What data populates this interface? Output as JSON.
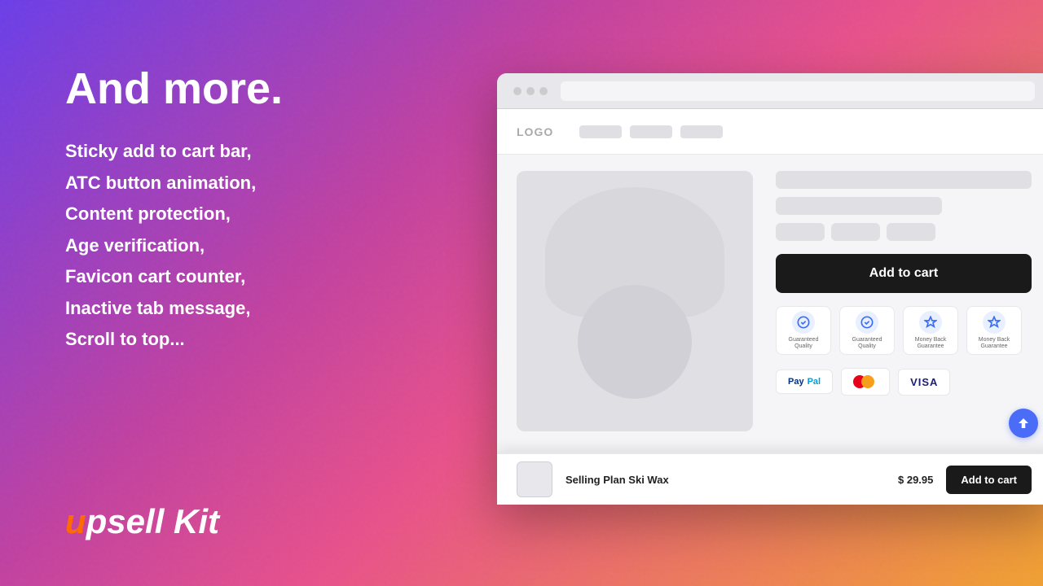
{
  "background": {
    "gradient": "linear-gradient(135deg, #6a3de8 0%, #c040a0 35%, #e8508a 55%, #f0a030 100%)"
  },
  "left_panel": {
    "headline": "And more.",
    "features": [
      "Sticky add to cart bar,",
      "ATC button animation,",
      "Content protection,",
      "Age verification,",
      "Favicon cart counter,",
      "Inactive tab message,",
      "Scroll to top..."
    ]
  },
  "logo": {
    "u": "u",
    "psell": "psell",
    "kit": " Kit"
  },
  "browser": {
    "nav": {
      "logo": "LOGO",
      "links": [
        "",
        "",
        ""
      ]
    },
    "product": {
      "add_to_cart_label": "Add to cart",
      "trust_badges": [
        {
          "icon": "✓",
          "text": "Guaranteed\nQuality"
        },
        {
          "icon": "✓",
          "text": "Guaranteed\nQuality"
        },
        {
          "icon": "$",
          "text": "Money Back\nGuarantee"
        },
        {
          "icon": "$",
          "text": "Money Back\nGuarantee"
        }
      ],
      "payment_methods": [
        "PayPal",
        "Mastercard",
        "VISA"
      ]
    },
    "sticky_bar": {
      "product_name": "Selling Plan Ski Wax",
      "price": "$ 29.95",
      "add_to_cart_label": "Add to cart"
    }
  }
}
